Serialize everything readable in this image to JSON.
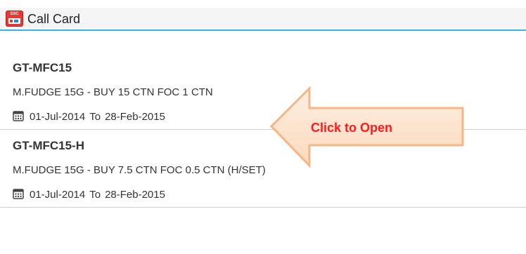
{
  "app": {
    "title": "Call Card",
    "icon_label": "SSC",
    "icon": "app-icon",
    "accent_color": "#33b5e5"
  },
  "items": [
    {
      "code": "GT-MFC15",
      "description": "M.FUDGE 15G - BUY 15 CTN FOC 1 CTN",
      "start_date": "01-Jul-2014",
      "to_label": "To",
      "end_date": "28-Feb-2015",
      "icon": "calendar-icon"
    },
    {
      "code": "GT-MFC15-H",
      "description": "M.FUDGE 15G - BUY 7.5 CTN FOC 0.5 CTN (H/SET)",
      "start_date": "01-Jul-2014",
      "to_label": "To",
      "end_date": "28-Feb-2015",
      "icon": "calendar-icon"
    }
  ],
  "annotation": {
    "label": "Click to Open",
    "icon": "left-arrow-icon",
    "label_color": "#ff1a1a",
    "arrow_fill": "#fde4cd",
    "arrow_stroke": "#f6b583"
  }
}
